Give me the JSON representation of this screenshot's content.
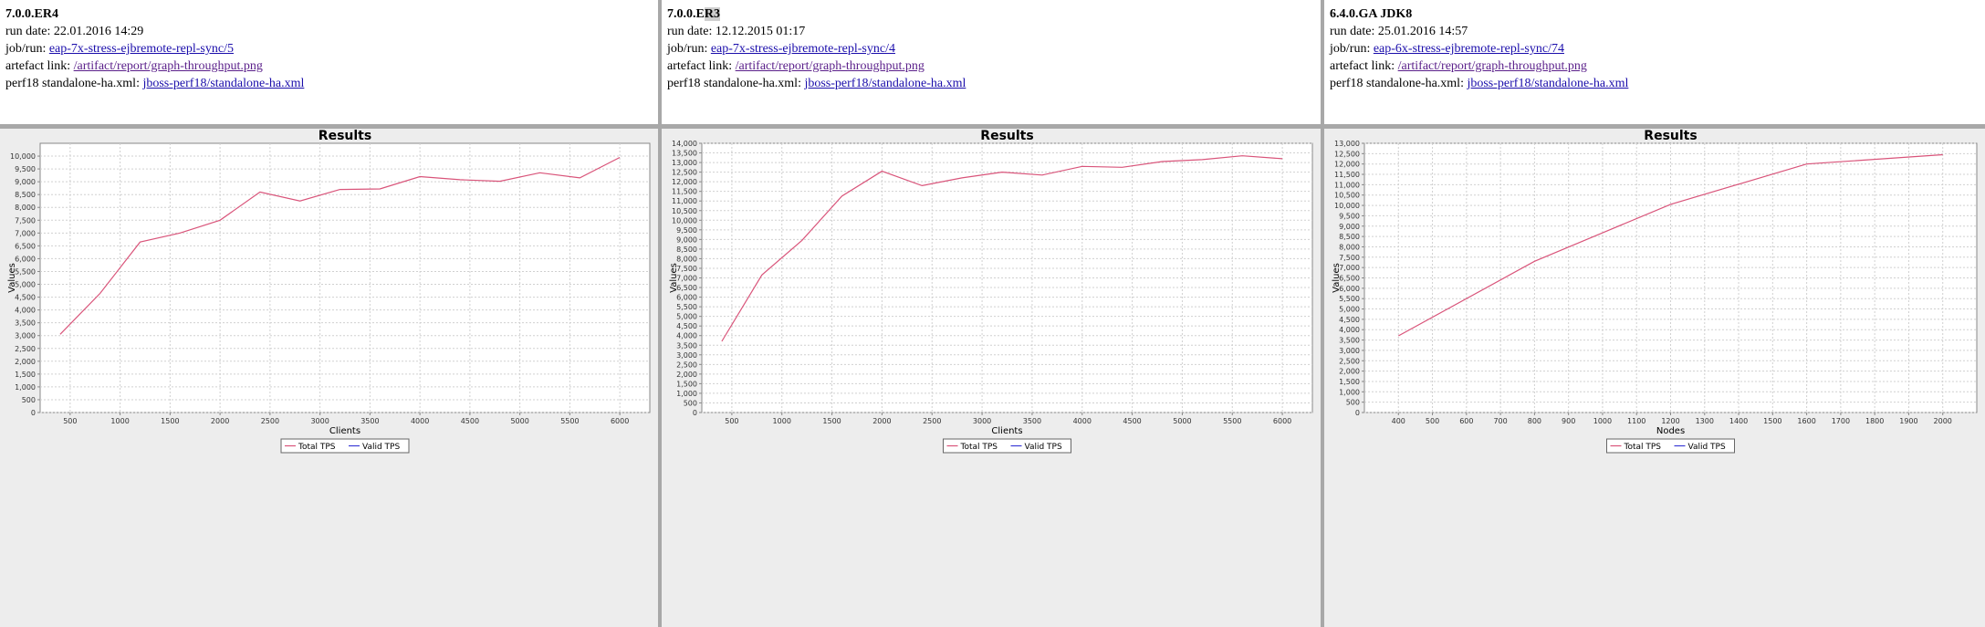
{
  "panels": [
    {
      "version": "7.0.0.ER4",
      "version_highlight": "",
      "run_date_label": "run date:",
      "run_date": "22.01.2016 14:29",
      "job_label": "job/run:",
      "job_link": "eap-7x-stress-ejbremote-repl-sync/5",
      "artefact_label": "artefact link:",
      "artefact_link": "/artifact/report/graph-throughput.png",
      "config_label": "perf18 standalone-ha.xml:",
      "config_link": "jboss-perf18/standalone-ha.xml",
      "chart_data": {
        "type": "line",
        "title": "Results",
        "xlabel": "Clients",
        "ylabel": "Values",
        "xlim": [
          200,
          6300
        ],
        "ylim": [
          0,
          10500
        ],
        "xticks": [
          500,
          1000,
          1500,
          2000,
          2500,
          3000,
          3500,
          4000,
          4500,
          5000,
          5500,
          6000
        ],
        "yticks": [
          0,
          500,
          1000,
          1500,
          2000,
          2500,
          3000,
          3500,
          4000,
          4500,
          5000,
          5500,
          6000,
          6500,
          7000,
          7500,
          8000,
          8500,
          9000,
          9500,
          10000
        ],
        "grid": true,
        "legend_position": "bottom",
        "series": [
          {
            "name": "Total TPS",
            "color": "#d9547a",
            "x": [
              400,
              800,
              1200,
              1600,
              2000,
              2400,
              2800,
              3200,
              3600,
              4000,
              4400,
              4800,
              5200,
              5600,
              6000
            ],
            "y": [
              3050,
              4650,
              6650,
              7000,
              7500,
              8600,
              8250,
              8700,
              8720,
              9200,
              9080,
              9020,
              9350,
              9150,
              9950
            ]
          },
          {
            "name": "Valid TPS",
            "color": "#3b3bd6",
            "x": [],
            "y": []
          }
        ]
      }
    },
    {
      "version": "7.0.0.E",
      "version_highlight": "R3",
      "run_date_label": "run date:",
      "run_date": "12.12.2015 01:17",
      "job_label": "job/run:",
      "job_link": "eap-7x-stress-ejbremote-repl-sync/4",
      "artefact_label": "artefact link:",
      "artefact_link": "/artifact/report/graph-throughput.png",
      "config_label": "perf18 standalone-ha.xml:",
      "config_link": "jboss-perf18/standalone-ha.xml",
      "chart_data": {
        "type": "line",
        "title": "Results",
        "xlabel": "Clients",
        "ylabel": "Values",
        "xlim": [
          200,
          6300
        ],
        "ylim": [
          0,
          14000
        ],
        "xticks": [
          500,
          1000,
          1500,
          2000,
          2500,
          3000,
          3500,
          4000,
          4500,
          5000,
          5500,
          6000
        ],
        "yticks": [
          0,
          500,
          1000,
          1500,
          2000,
          2500,
          3000,
          3500,
          4000,
          4500,
          5000,
          5500,
          6000,
          6500,
          7000,
          7500,
          8000,
          8500,
          9000,
          9500,
          10000,
          10500,
          11000,
          11500,
          12000,
          12500,
          13000,
          13500,
          14000
        ],
        "grid": true,
        "legend_position": "bottom",
        "series": [
          {
            "name": "Total TPS",
            "color": "#d9547a",
            "x": [
              400,
              800,
              1200,
              1600,
              2000,
              2400,
              2800,
              3200,
              3600,
              4000,
              4400,
              4800,
              5200,
              5600,
              6000
            ],
            "y": [
              3700,
              7150,
              8950,
              11250,
              12550,
              11800,
              12200,
              12500,
              12350,
              12800,
              12750,
              13050,
              13150,
              13350,
              13200
            ]
          },
          {
            "name": "Valid TPS",
            "color": "#3b3bd6",
            "x": [],
            "y": []
          }
        ]
      }
    },
    {
      "version": "6.4.0.GA JDK8",
      "version_highlight": "",
      "run_date_label": "run date:",
      "run_date": "25.01.2016 14:57",
      "job_label": "job/run:",
      "job_link": "eap-6x-stress-ejbremote-repl-sync/74",
      "artefact_label": "artefact link:",
      "artefact_link": "/artifact/report/graph-throughput.png",
      "config_label": "perf18 standalone-ha.xml:",
      "config_link": "jboss-perf18/standalone-ha.xml",
      "chart_data": {
        "type": "line",
        "title": "Results",
        "xlabel": "Nodes",
        "ylabel": "Values",
        "xlim": [
          300,
          2100
        ],
        "ylim": [
          0,
          13000
        ],
        "xticks": [
          400,
          500,
          600,
          700,
          800,
          900,
          1000,
          1100,
          1200,
          1300,
          1400,
          1500,
          1600,
          1700,
          1800,
          1900,
          2000
        ],
        "yticks": [
          0,
          500,
          1000,
          1500,
          2000,
          2500,
          3000,
          3500,
          4000,
          4500,
          5000,
          5500,
          6000,
          6500,
          7000,
          7500,
          8000,
          8500,
          9000,
          9500,
          10000,
          10500,
          11000,
          11500,
          12000,
          12500,
          13000
        ],
        "grid": true,
        "legend_position": "bottom",
        "series": [
          {
            "name": "Total TPS",
            "color": "#d9547a",
            "x": [
              400,
              800,
              1200,
              1600,
              2000
            ],
            "y": [
              3700,
              7300,
              10050,
              12000,
              12450
            ]
          },
          {
            "name": "Valid TPS",
            "color": "#3b3bd6",
            "x": [],
            "y": []
          }
        ]
      }
    }
  ]
}
